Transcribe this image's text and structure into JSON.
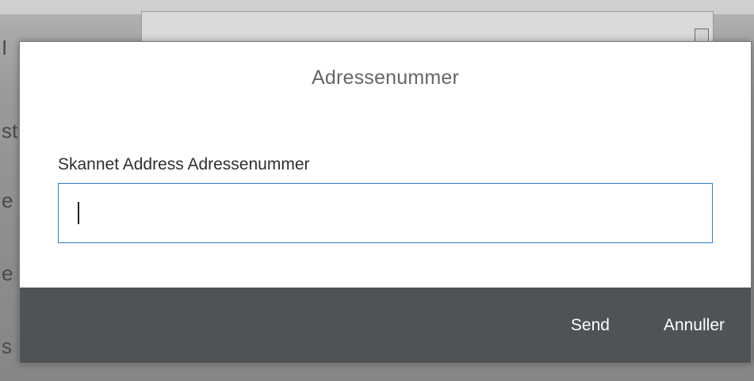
{
  "background": {
    "letters": [
      "I",
      "st",
      "e",
      "e",
      "s"
    ]
  },
  "dialog": {
    "title": "Adressenummer",
    "field_label": "Skannet Address Adressenummer",
    "input_value": "",
    "input_placeholder": "",
    "send_label": "Send",
    "cancel_label": "Annuller"
  },
  "colors": {
    "footer_bg": "#4f5355",
    "input_border": "#2b7bd3",
    "title_text": "#666666"
  }
}
